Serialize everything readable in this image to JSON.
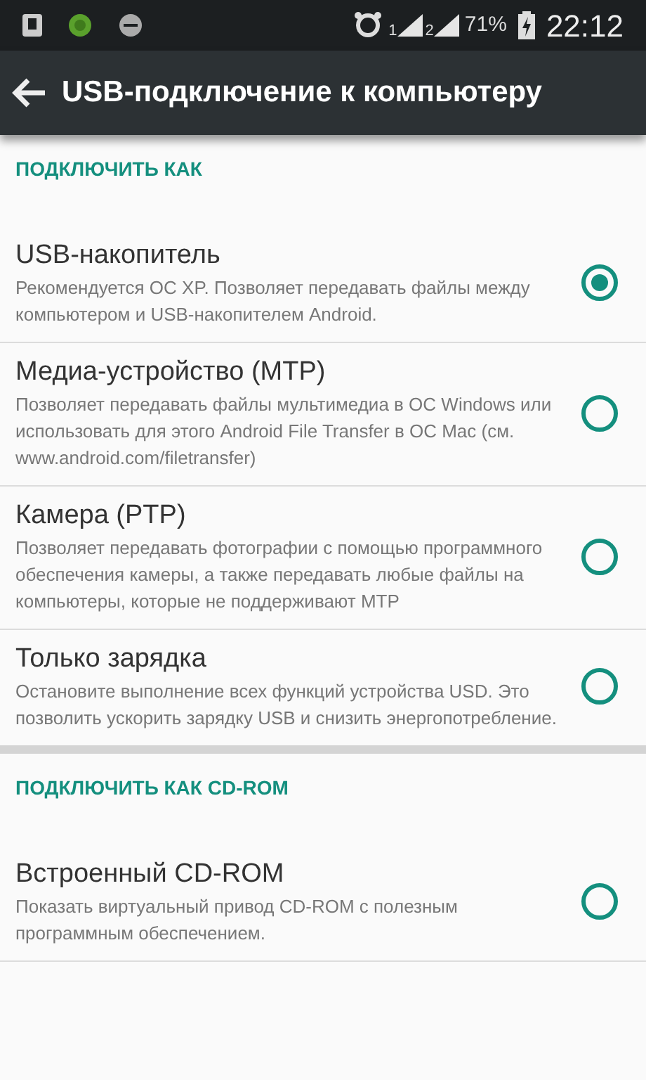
{
  "status_bar": {
    "sim_1": "1",
    "sim_2": "2",
    "battery": "71%",
    "time": "22:12"
  },
  "app_bar": {
    "title": "USB-подключение к компьютеру"
  },
  "sections": [
    {
      "header": "ПОДКЛЮЧИТЬ КАК",
      "options": [
        {
          "title": "USB-накопитель",
          "summary": "Рекомендуется ОС XP. Позволяет передавать файлы между компьютером и USB-накопителем Android.",
          "selected": true
        },
        {
          "title": "Медиа-устройство (MTP)",
          "summary": "Позволяет передавать файлы мультимедиа в ОС Windows или использовать для этого Android File Transfer в ОС Mac (см. www.android.com/filetransfer)",
          "selected": false
        },
        {
          "title": "Камера (PTP)",
          "summary": "Позволяет передавать фотографии с помощью программного обеспечения камеры, а также передавать любые файлы на компьютеры, которые не поддерживают MTP",
          "selected": false
        },
        {
          "title": "Только зарядка",
          "summary": "Остановите выполнение всех функций устройства USD. Это позволить ускорить зарядку USB и снизить энергопотребление.",
          "selected": false
        }
      ]
    },
    {
      "header": "ПОДКЛЮЧИТЬ КАК CD-ROM",
      "options": [
        {
          "title": "Встроенный CD-ROM",
          "summary": "Показать виртуальный привод CD-ROM с полезным программным обеспечением.",
          "selected": false
        }
      ]
    }
  ]
}
